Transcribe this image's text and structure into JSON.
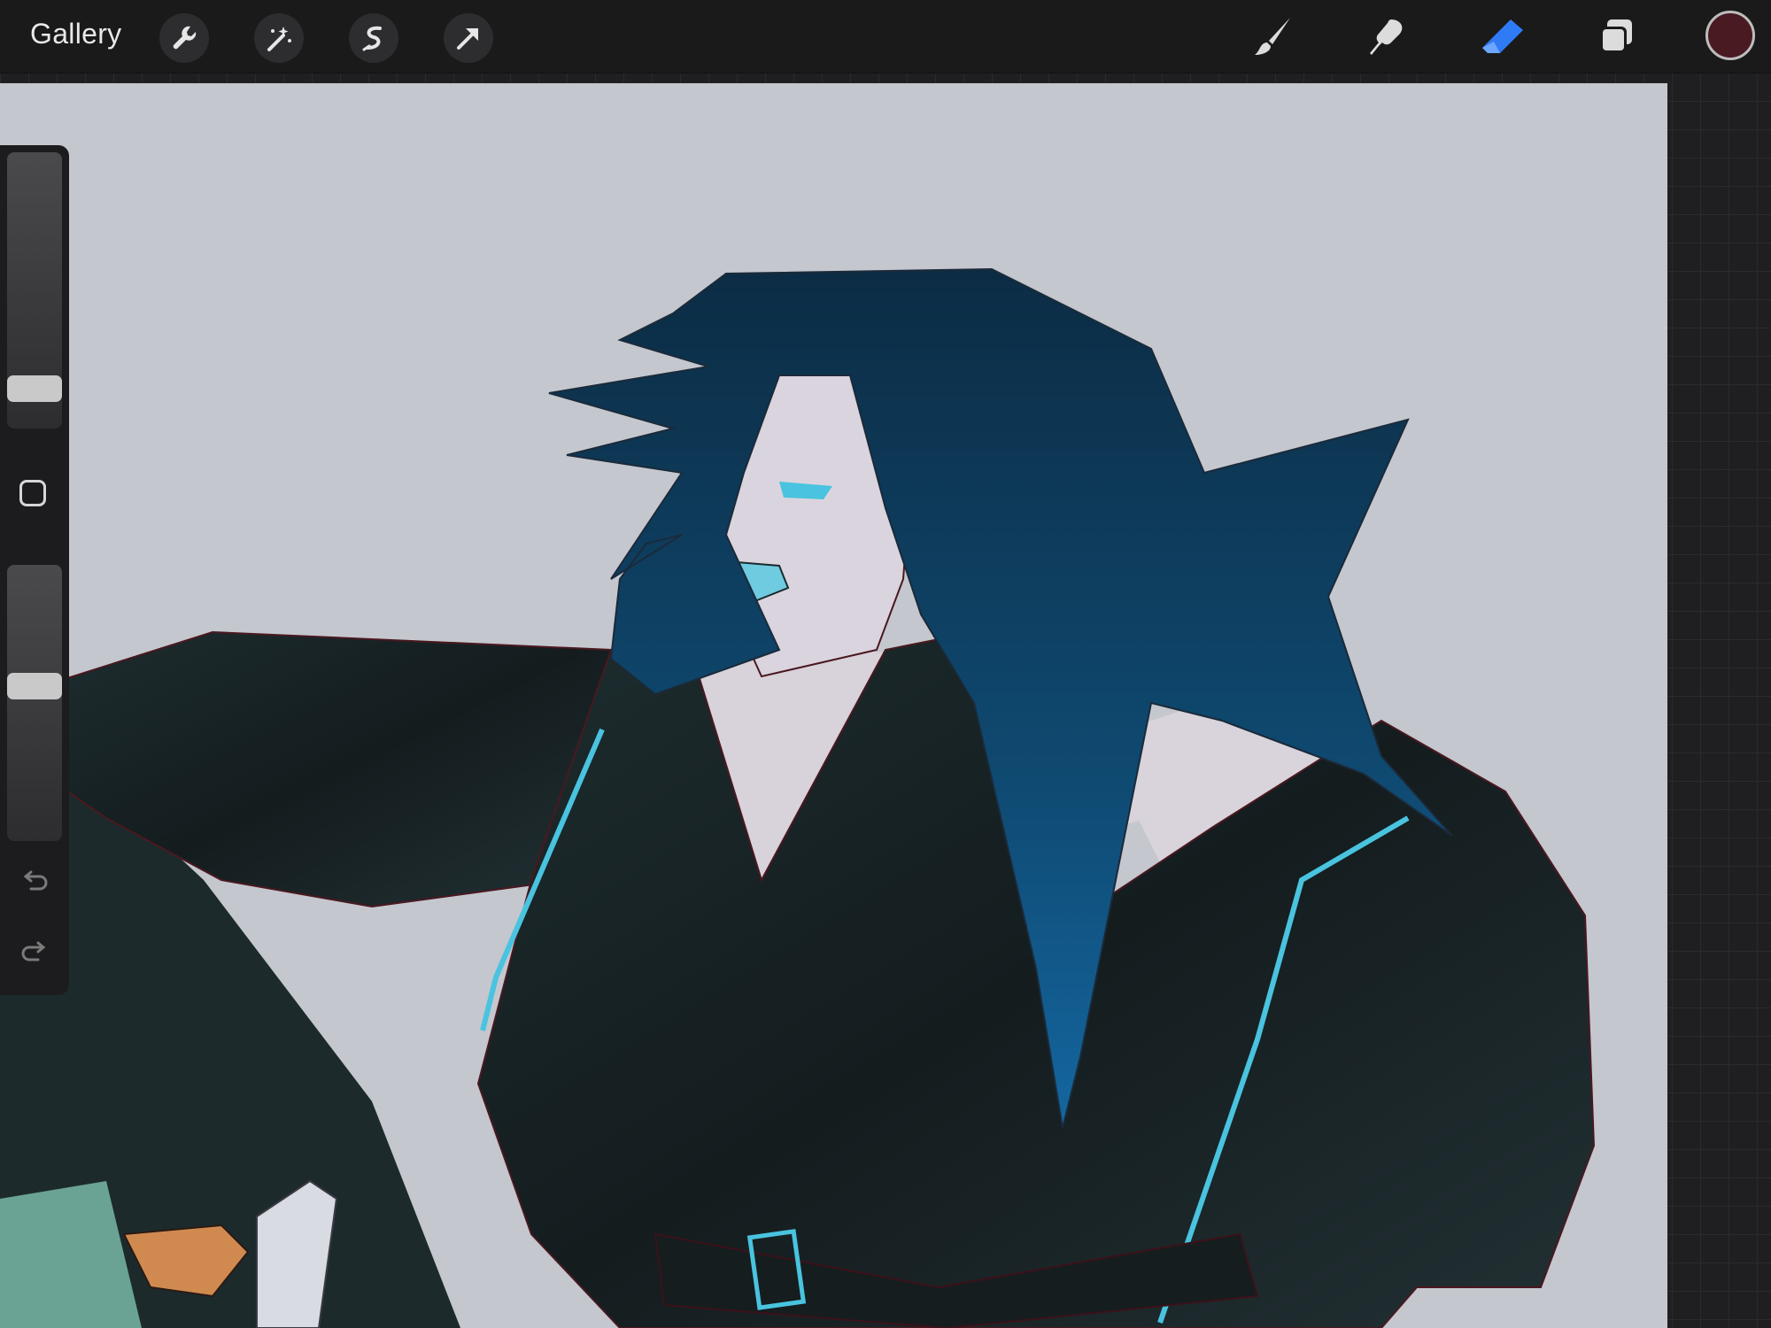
{
  "topbar": {
    "gallery_label": "Gallery",
    "left_tools": [
      {
        "icon": "wrench-icon",
        "name": "actions"
      },
      {
        "icon": "magic-wand-icon",
        "name": "adjustments"
      },
      {
        "icon": "s-selection-icon",
        "name": "selection"
      },
      {
        "icon": "arrow-cursor-icon",
        "name": "transform"
      }
    ],
    "right_tools": [
      {
        "icon": "brush-icon",
        "name": "paint",
        "active": false
      },
      {
        "icon": "smudge-icon",
        "name": "smudge",
        "active": false
      },
      {
        "icon": "eraser-icon",
        "name": "erase",
        "active": true
      },
      {
        "icon": "layers-icon",
        "name": "layers",
        "active": false
      }
    ],
    "current_color": "#4a1a22",
    "accent_color": "#2f7bf5"
  },
  "sidebar": {
    "brush_size_level": 0.12,
    "opacity_level": 0.55,
    "controls": [
      "modify-square-icon",
      "undo-icon",
      "redo-icon"
    ]
  },
  "canvas": {
    "background_color": "#c4c7ce",
    "artwork_palette": {
      "hair": "#0f3d5c",
      "jacket": "#1a2528",
      "outline": "#5b1a25",
      "accent_line": "#49c3df",
      "skin": "#d9d3dc"
    }
  }
}
